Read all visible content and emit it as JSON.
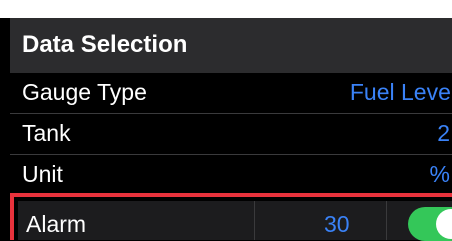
{
  "header": {
    "title": "Data Selection"
  },
  "rows": [
    {
      "label": "Gauge Type",
      "value": "Fuel Level"
    },
    {
      "label": "Tank",
      "value": "2"
    },
    {
      "label": "Unit",
      "value": "%"
    }
  ],
  "alarm": {
    "label": "Alarm",
    "value": "30",
    "enabled": true
  },
  "colors": {
    "accent": "#3a82f7",
    "toggle_on": "#34c759",
    "highlight": "#e8323c"
  }
}
